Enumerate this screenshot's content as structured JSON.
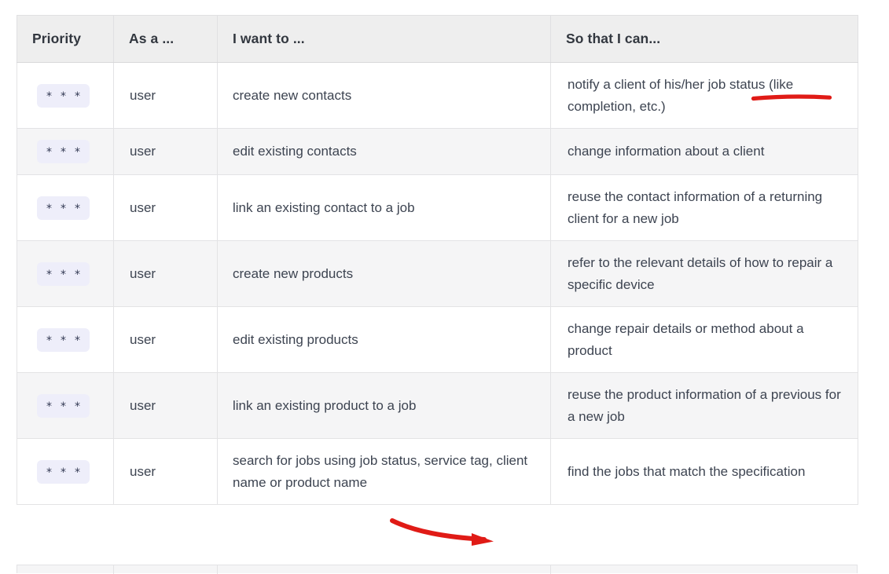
{
  "table": {
    "columns": [
      {
        "key": "priority",
        "label": "Priority"
      },
      {
        "key": "role",
        "label": "As a ..."
      },
      {
        "key": "want",
        "label": "I want to ..."
      },
      {
        "key": "sothat",
        "label": "So that I can..."
      }
    ],
    "priority_symbol": "*",
    "rows": [
      {
        "priority": [
          "*",
          "*",
          "*"
        ],
        "role": "user",
        "want": "create new contacts",
        "sothat": "notify a client of his/her job status (like completion, etc.)"
      },
      {
        "priority": [
          "*",
          "*",
          "*"
        ],
        "role": "user",
        "want": "edit existing contacts",
        "sothat": "change information about a client"
      },
      {
        "priority": [
          "*",
          "*",
          "*"
        ],
        "role": "user",
        "want": "link an existing contact to a job",
        "sothat": "reuse the contact information of a returning client for a new job"
      },
      {
        "priority": [
          "*",
          "*",
          "*"
        ],
        "role": "user",
        "want": "create new products",
        "sothat": "refer to the relevant details of how to repair a specific device"
      },
      {
        "priority": [
          "*",
          "*",
          "*"
        ],
        "role": "user",
        "want": "edit existing products",
        "sothat": "change repair details or method about a product"
      },
      {
        "priority": [
          "*",
          "*",
          "*"
        ],
        "role": "user",
        "want": "link an existing product to a job",
        "sothat": "reuse the product information of a previous for a new job"
      },
      {
        "priority": [
          "*",
          "*",
          "*"
        ],
        "role": "user",
        "want": "search for jobs using job status, service tag, client name or product name",
        "sothat": "find the jobs that match the specification"
      }
    ]
  },
  "annotations": [
    {
      "name": "underline-job-status",
      "type": "underline",
      "target_text": "job status",
      "color": "#e01b16"
    },
    {
      "name": "arrow-search-job-status",
      "type": "arrow",
      "target_text": "search for jobs using job status",
      "color": "#e01b16"
    }
  ],
  "colors": {
    "header_bg": "#eeeeee",
    "row_bg": "#ffffff",
    "row_alt_bg": "#f5f5f6",
    "border": "#e3e3e5",
    "text": "#3d4451",
    "chip_bg": "#eeeefa",
    "chip_text": "#333a54",
    "annotation_red": "#e01b16"
  }
}
